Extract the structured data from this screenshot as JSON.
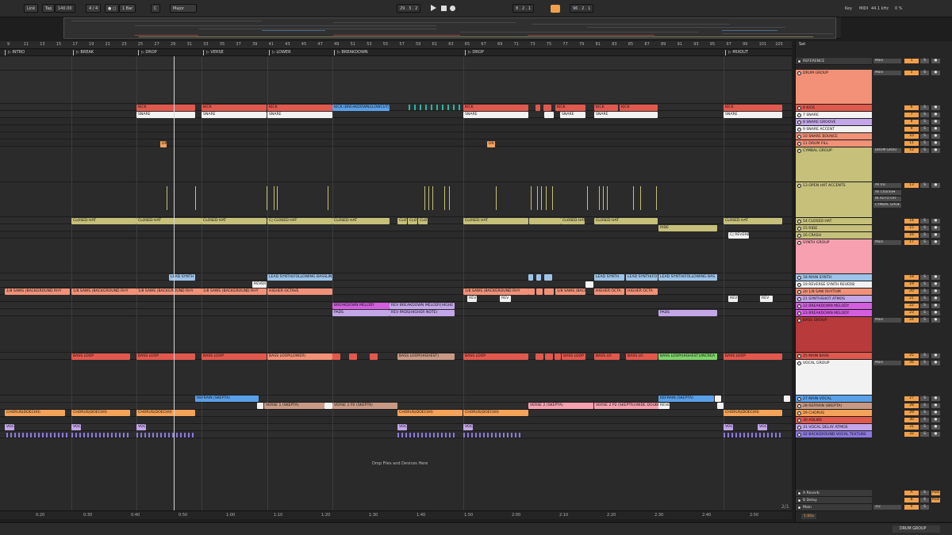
{
  "transport": {
    "link": "Link",
    "tap": "Tap",
    "tempo": "140.00",
    "signature": "4 / 4",
    "metronome": "● ○",
    "quantize": "1 Bar",
    "key_root": "C",
    "key_scale": "Major",
    "position": "29 .  3 .  2",
    "loop_start": "8 .  2 .  1",
    "loop_length": "96 .  2 .  1",
    "key_label": "Key",
    "midi_label": "MIDI",
    "sample_rate": "44.1 kHz",
    "cpu": "0 %"
  },
  "colors": {
    "red": "#e2584d",
    "salmon": "#f29177",
    "white": "#f2f2f2",
    "olive": "#c6c07a",
    "pink": "#f7a0b0",
    "blue": "#5aa0e8",
    "lightblue": "#9ec3e8",
    "lavender": "#c2a6e8",
    "orange": "#f4a35a",
    "magenta": "#d35ee0",
    "green": "#7fd36a",
    "purple": "#8c78e0",
    "darkred": "#b83a3a",
    "tan": "#c89a86"
  },
  "ruler_ticks": [
    "9",
    "11",
    "13",
    "15",
    "17",
    "19",
    "21",
    "23",
    "25",
    "27",
    "29",
    "31",
    "33",
    "35",
    "37",
    "39",
    "41",
    "43",
    "45",
    "47",
    "49",
    "51",
    "53",
    "55",
    "57",
    "59",
    "61",
    "63",
    "65",
    "67",
    "69",
    "71",
    "73",
    "75",
    "77",
    "79",
    "81",
    "83",
    "85",
    "87",
    "89",
    "91",
    "93",
    "95",
    "97",
    "99",
    "101",
    "103"
  ],
  "locators": [
    "INTRO",
    "BREAK",
    "DROP",
    "VERSE",
    "LOWER",
    "BREAKDOWN",
    "DROP",
    "MIXOUT"
  ],
  "time_ticks": [
    "0:20",
    "0:30",
    "0:40",
    "0:50",
    "1:00",
    "1:10",
    "1:20",
    "1:30",
    "1:40",
    "1:50",
    "2:00",
    "2:10",
    "2:20",
    "2:30",
    "2:40",
    "2:50"
  ],
  "drop_text": "Drop Files and Devices Here",
  "mixer": {
    "set_label": "Set",
    "tracks": [
      {
        "label": "REFERENCE",
        "io": "Main",
        "num": "1"
      },
      {
        "label": "DRUM GROUP",
        "io": "Main",
        "num": "5"
      },
      {
        "label": "6 KICK",
        "num": "6"
      },
      {
        "label": "7 SNARE",
        "num": "7"
      },
      {
        "label": "8 SNARE GROOVE",
        "num": "8"
      },
      {
        "label": "9 SNARE  ACCENT",
        "num": "9"
      },
      {
        "label": "10 SNARE BOUNCE",
        "num": "10"
      },
      {
        "label": "11 DRUM FILL",
        "num": "11"
      },
      {
        "label": "CYMBAL GROUP",
        "io": "DRUM GROU",
        "num": "12"
      },
      {
        "label": "13 OPEN HAT ACCENTS",
        "io": "All Ins",
        "num": "13"
      },
      {
        "label": "14 CLOSED HAT",
        "num": "14"
      },
      {
        "label": "15 RIDE",
        "num": "15"
      },
      {
        "label": "16 CRASH",
        "num": "16"
      },
      {
        "label": "SYNTH GROUP",
        "io": "Main",
        "num": "17"
      },
      {
        "label": "18 MAIN SYNTH",
        "num": "18"
      },
      {
        "label": "19 REVERSE SYNTH REVERB",
        "num": "19"
      },
      {
        "label": "20 1/8 SAW RHYTHM",
        "num": "20"
      },
      {
        "label": "21 SYNTHSHOT ATMOS",
        "num": "21"
      },
      {
        "label": "22 BREAKDOWN MELODY",
        "num": "22"
      },
      {
        "label": "23 BREAKDOWN MELODY",
        "num": "23"
      },
      {
        "label": "BASS GROUP",
        "io": "Main",
        "num": "24"
      },
      {
        "label": "25 MAIN BASS",
        "num": "25"
      },
      {
        "label": "VOCAL GROUP",
        "io": "Main",
        "num": "26"
      },
      {
        "label": "27 MAIN VOCAL",
        "num": "27"
      },
      {
        "label": "28 REFRAIN (SKEPTA)",
        "num": "28"
      },
      {
        "label": "29 CHORUS",
        "num": "29"
      },
      {
        "label": "30 ADLIBS",
        "num": "30"
      },
      {
        "label": "31 VOCAL DELAY ATMOS",
        "num": "31"
      },
      {
        "label": "32 BACKGROUND VOCAL TEXTURE",
        "num": "32"
      }
    ],
    "returns": [
      {
        "label": "A Reverb",
        "num": "A",
        "btn": "Post"
      },
      {
        "label": "B Delay",
        "num": "B",
        "btn": "Post"
      },
      {
        "label": "Main",
        "num": "0",
        "io": "1/2"
      }
    ],
    "cymbal_io_extra": [
      "All Channe▾",
      "IN  AUTO  OFF",
      "CYMBAL GRO▾"
    ],
    "solo_label": "S",
    "zoom_value": "1.00x",
    "bottom_group": "DRUM GROUP",
    "page_indicator": "2/1"
  },
  "clips": {
    "kick": "KICK",
    "kick_breakdown": "KICK (BREAKDOWN)(LOWCUT)",
    "snare": "SNARE",
    "dr": "DR",
    "closed_hat": "CLOSED HAT",
    "c_closed_hat": "C| CLOSED HAT",
    "clo": "CLO",
    "ride": "RIDE",
    "crash": "C| REVERB",
    "lead_synth": "LEAD SYNTH",
    "lead_synth_follow": "LEAD SYNTH(FOLLOWING BASSLIN",
    "lead_synth_fo": "LEAD SYNTH(FO",
    "lead_synth_follow2": "LEAD SYNTH(FOLLOWING BAS",
    "rever": "REVER",
    "saws": "1/8 SAWS (BACKGROUND RHY",
    "higher_octave": "HIGHER OCTAVE",
    "higher_oct": "HIGHER OCTA",
    "breakdown_melody": "BREAKDOWN MELODY",
    "rev_breakdown_melody": "REV BREAKDOWN MELODY(HIGHE",
    "pads": "PADS",
    "rev_pads": "REV PADS(HIGHER NOTE)",
    "rev": "REV",
    "bass_loop": "BASS LOOP",
    "bass_loop_lower": "BASS LOOP(LOWER)",
    "bass_loop_highest": "BASS LOOP(HIGHEST)",
    "bass_loop_ba": "BASS LO",
    "bass_loop_hi_inc": "BASS LOOP(HIGHEST)(INCREA",
    "refrain": "REFRAIN (SKEPTA)",
    "verse1": "VERSE 1 (SKEPTA)",
    "verse1p2": "VERSE 1 P2 (SKEPTA)",
    "verse2": "VERSE 2 (SKEPTA)",
    "verse2p2": "VERSE 2 P2 (SKEPTA)(WIDE DOUBL",
    "reve": "REVE",
    "chorus": "CHORUS(DOECHII)",
    "voc": "VOC"
  }
}
